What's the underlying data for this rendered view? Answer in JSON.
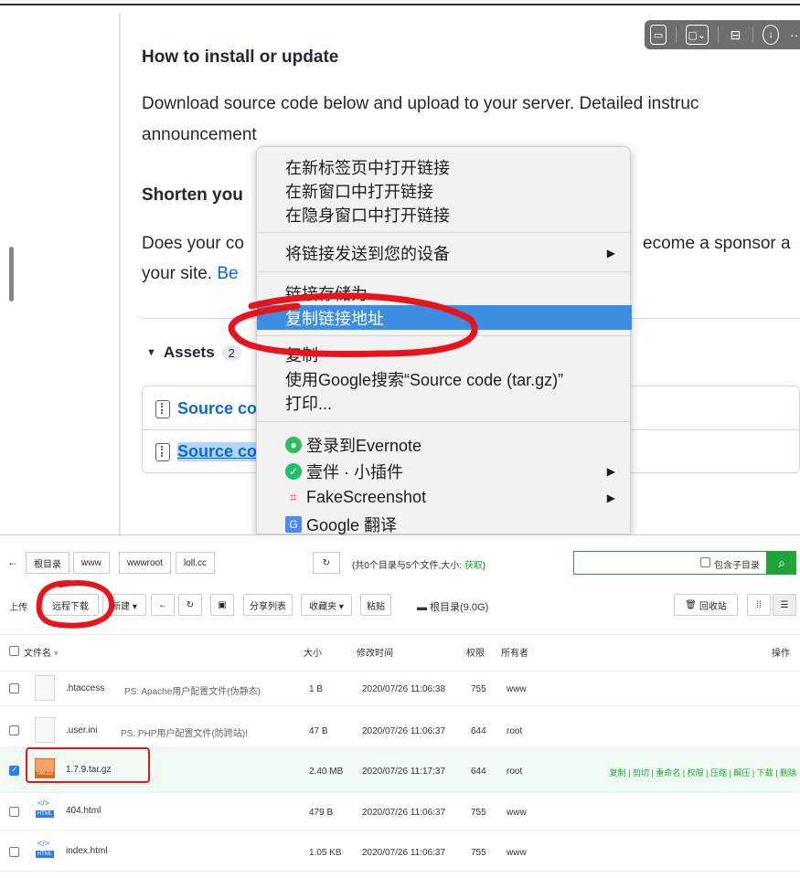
{
  "release": {
    "heading_install": "How to install or update",
    "install_line1": "Download source code below and upload to your server. Detailed instruc",
    "install_line2": "announcement",
    "heading_shorten": "Shorten you",
    "shorten_line1_a": "Does your co",
    "shorten_line1_b": "ecome a sponsor a",
    "shorten_line2_a": "your site. ",
    "shorten_line2_link": "Be",
    "assets_label": "Assets",
    "assets_count": "2",
    "asset1": "Source co",
    "asset2": "Source co"
  },
  "context_menu": {
    "items": [
      "在新标签页中打开链接",
      "在新窗口中打开链接",
      "在隐身窗口中打开链接",
      "将链接发送到您的设备",
      "链接存储为...",
      "复制链接地址",
      "复制",
      "使用Google搜索“Source code (tar.gz)”",
      "打印...",
      "登录到Evernote",
      "壹伴 · 小插件",
      "FakeScreenshot",
      "Google 翻译"
    ],
    "highlighted": "复制链接地址"
  },
  "file_manager": {
    "breadcrumb": [
      "根目录",
      "www",
      "wwwroot",
      "loll.cc"
    ],
    "dir_info_prefix": "(共0个目录与5个文件,大小: ",
    "dir_info_link": "获取",
    "dir_info_suffix": ")",
    "include_subdir": "包含子目录",
    "toolbar": {
      "upload": "上传",
      "remote_download": "远程下载",
      "new": "新建 ▾",
      "share_list": "分享列表",
      "favorites": "收藏夹 ▾",
      "paste": "粘贴",
      "disk": "根目录(9.0G)",
      "recycle": "回收站"
    },
    "columns": {
      "name": "文件名",
      "size": "大小",
      "modified": "修改时间",
      "perm": "权限",
      "owner": "所有者",
      "ops": "操作"
    },
    "rows": [
      {
        "name": ".htaccess",
        "note": "PS: Apache用户配置文件(伪静态)",
        "size": "1 B",
        "modified": "2020/07/26 11:06:38",
        "perm": "755",
        "owner": "www"
      },
      {
        "name": ".user.ini",
        "note": "PS: PHP用户配置文件(防跨站)!",
        "size": "47 B",
        "modified": "2020/07/26 11:06:37",
        "perm": "644",
        "owner": "root"
      },
      {
        "name": "1.7.9.tar.gz",
        "note": "",
        "size": "2.40 MB",
        "modified": "2020/07/26 11:17:37",
        "perm": "644",
        "owner": "root",
        "actions": "复制 | 剪切 | 重命名 | 权限 | 压缩 | 解压 | 下载 | 删除"
      },
      {
        "name": "404.html",
        "note": "",
        "size": "479 B",
        "modified": "2020/07/26 11:06:37",
        "perm": "755",
        "owner": "www"
      },
      {
        "name": "index.html",
        "note": "",
        "size": "1.05 KB",
        "modified": "2020/07/26 11:06:37",
        "perm": "755",
        "owner": "www"
      }
    ],
    "file_icon_label": "HTML",
    "archive_icon_label": "TAR.GZ"
  }
}
